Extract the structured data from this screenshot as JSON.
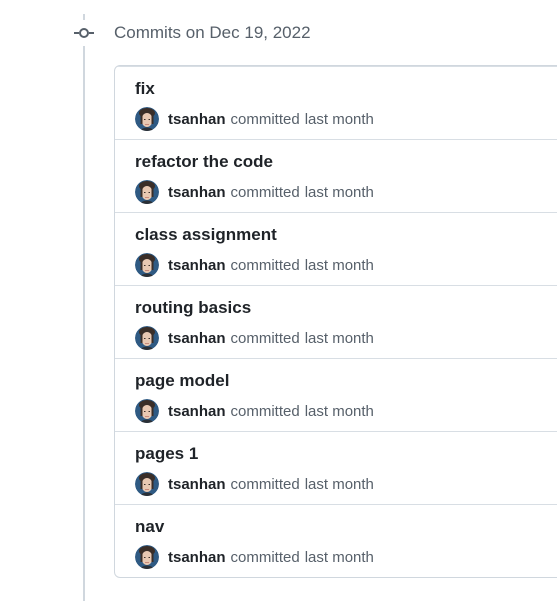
{
  "group": {
    "title": "Commits on Dec 19, 2022",
    "icon": "git-commit-icon"
  },
  "colors": {
    "border": "#d0d7de",
    "muted_text": "#57606a",
    "primary_text": "#1f2328",
    "highlight_row_bg": "#f6f8fa"
  },
  "commits": [
    {
      "message": "fix",
      "author": "tsanhan",
      "verb": "committed",
      "time": "last month"
    },
    {
      "message": "refactor the code",
      "author": "tsanhan",
      "verb": "committed",
      "time": "last month"
    },
    {
      "message": "class assignment",
      "author": "tsanhan",
      "verb": "committed",
      "time": "last month"
    },
    {
      "message": "routing basics",
      "author": "tsanhan",
      "verb": "committed",
      "time": "last month"
    },
    {
      "message": "page model",
      "author": "tsanhan",
      "verb": "committed",
      "time": "last month"
    },
    {
      "message": "pages 1",
      "author": "tsanhan",
      "verb": "committed",
      "time": "last month"
    },
    {
      "message": "nav",
      "author": "tsanhan",
      "verb": "committed",
      "time": "last month"
    }
  ]
}
